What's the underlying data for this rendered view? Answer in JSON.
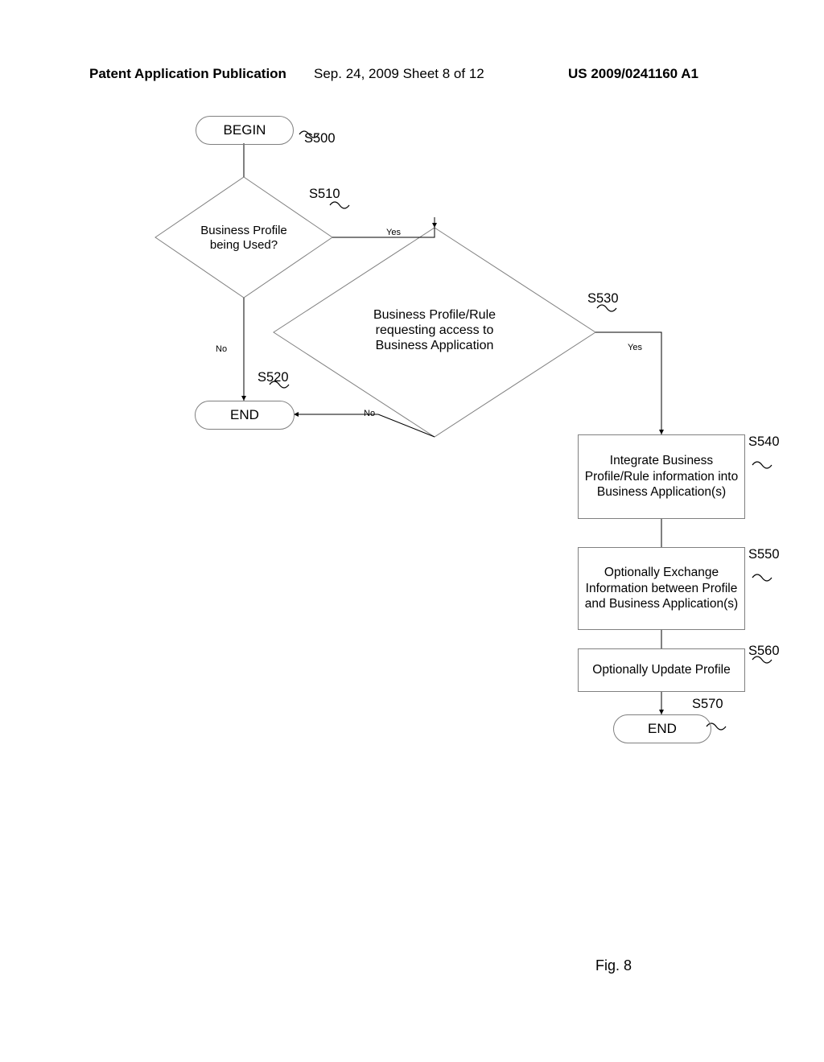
{
  "header": {
    "left": "Patent Application Publication",
    "center": "Sep. 24, 2009  Sheet 8 of 12",
    "right": "US 2009/0241160 A1"
  },
  "figure_label": "Fig. 8",
  "nodes": {
    "begin": {
      "label": "BEGIN",
      "ref": "S500"
    },
    "d1": {
      "label": "Business Profile\nbeing Used?",
      "ref": "S510"
    },
    "end1": {
      "label": "END",
      "ref": "S520"
    },
    "d2": {
      "label": "Business Profile/Rule\nrequesting access to\nBusiness Application",
      "ref": "S530"
    },
    "p1": {
      "label": "Integrate Business\nProfile/Rule information\ninto Business\nApplication(s)",
      "ref": "S540"
    },
    "p2": {
      "label": "Optionally Exchange\nInformation between\nProfile and Business\nApplication(s)",
      "ref": "S550"
    },
    "p3": {
      "label": "Optionally Update\nProfile",
      "ref": "S560"
    },
    "end2": {
      "label": "END",
      "ref": "S570"
    }
  },
  "edges": {
    "yes1": "Yes",
    "no1": "No",
    "yes2": "Yes",
    "no2": "No"
  },
  "chart_data": {
    "type": "flowchart",
    "nodes": [
      {
        "id": "S500",
        "kind": "terminator",
        "text": "BEGIN"
      },
      {
        "id": "S510",
        "kind": "decision",
        "text": "Business Profile being Used?"
      },
      {
        "id": "S520",
        "kind": "terminator",
        "text": "END"
      },
      {
        "id": "S530",
        "kind": "decision",
        "text": "Business Profile/Rule requesting access to Business Application"
      },
      {
        "id": "S540",
        "kind": "process",
        "text": "Integrate Business Profile/Rule information into Business Application(s)"
      },
      {
        "id": "S550",
        "kind": "process",
        "text": "Optionally Exchange Information between Profile and Business Application(s)"
      },
      {
        "id": "S560",
        "kind": "process",
        "text": "Optionally Update Profile"
      },
      {
        "id": "S570",
        "kind": "terminator",
        "text": "END"
      }
    ],
    "edges": [
      {
        "from": "S500",
        "to": "S510",
        "label": ""
      },
      {
        "from": "S510",
        "to": "S530",
        "label": "Yes"
      },
      {
        "from": "S510",
        "to": "S520",
        "label": "No"
      },
      {
        "from": "S530",
        "to": "S540",
        "label": "Yes"
      },
      {
        "from": "S530",
        "to": "S520",
        "label": "No"
      },
      {
        "from": "S540",
        "to": "S550",
        "label": ""
      },
      {
        "from": "S550",
        "to": "S560",
        "label": ""
      },
      {
        "from": "S560",
        "to": "S570",
        "label": ""
      }
    ]
  }
}
